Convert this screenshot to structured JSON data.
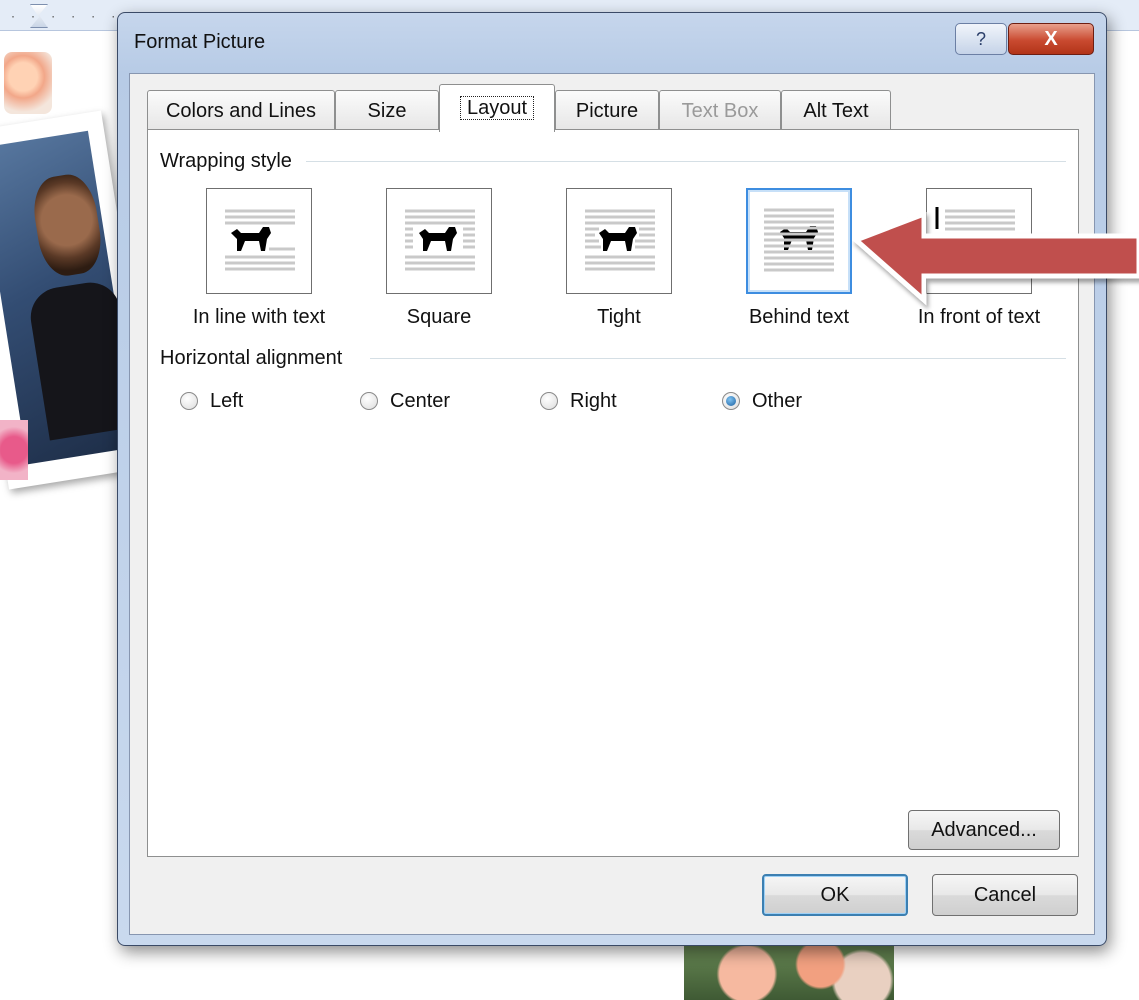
{
  "dialog": {
    "title": "Format Picture",
    "help_label": "?",
    "close_label": "X",
    "tabs": [
      {
        "label": "Colors and Lines",
        "state": "normal"
      },
      {
        "label": "Size",
        "state": "normal"
      },
      {
        "label": "Layout",
        "state": "active"
      },
      {
        "label": "Picture",
        "state": "normal"
      },
      {
        "label": "Text Box",
        "state": "disabled"
      },
      {
        "label": "Alt Text",
        "state": "normal"
      }
    ],
    "wrapping_style_label": "Wrapping style",
    "wrapping_options": [
      {
        "label": "In line with text",
        "selected": false
      },
      {
        "label": "Square",
        "selected": false
      },
      {
        "label": "Tight",
        "selected": false
      },
      {
        "label": "Behind text",
        "selected": true
      },
      {
        "label": "In front of text",
        "selected": false
      }
    ],
    "horizontal_alignment_label": "Horizontal alignment",
    "alignment_options": [
      {
        "label": "Left",
        "checked": false
      },
      {
        "label": "Center",
        "checked": false
      },
      {
        "label": "Right",
        "checked": false
      },
      {
        "label": "Other",
        "checked": true
      }
    ],
    "advanced_label": "Advanced...",
    "ok_label": "OK",
    "cancel_label": "Cancel"
  },
  "colors": {
    "selection_border": "#3d8de0",
    "arrow_fill": "#c0504d",
    "close_button": "#c94a30"
  }
}
